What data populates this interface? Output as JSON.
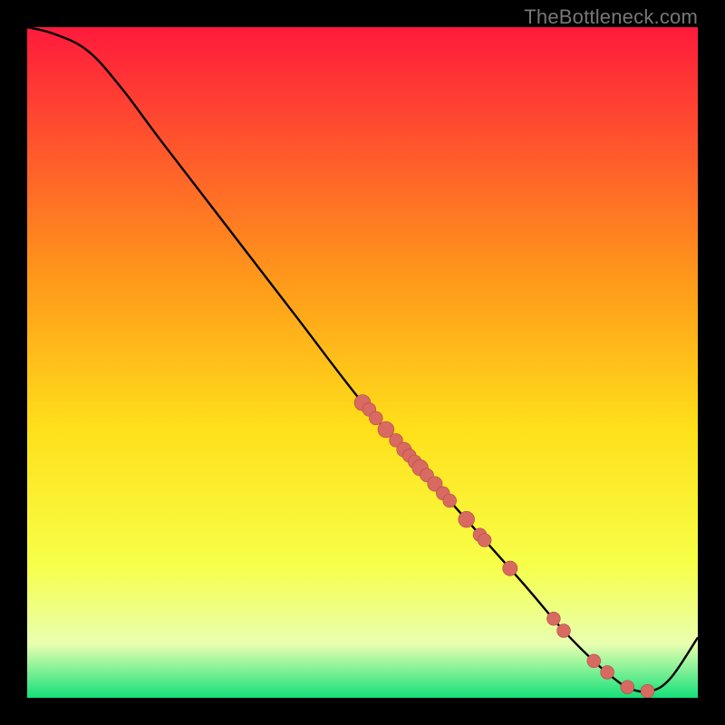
{
  "attribution": "TheBottleneck.com",
  "colors": {
    "gradient_top": "#ff1a3c",
    "gradient_upper_mid": "#ff9a1a",
    "gradient_mid": "#ffe01a",
    "gradient_lower_mid": "#f7ff48",
    "gradient_low": "#e8ffb0",
    "gradient_bottom": "#14e07a",
    "curve": "#000000",
    "dot_fill": "#d86a62",
    "dot_stroke": "#b04a44",
    "frame": "#000000"
  },
  "chart_data": {
    "type": "line",
    "title": "",
    "xlabel": "",
    "ylabel": "",
    "xlim": [
      0,
      100
    ],
    "ylim": [
      0,
      100
    ],
    "curve": {
      "x": [
        0,
        4,
        9,
        14,
        20,
        30,
        40,
        50,
        58,
        66,
        74,
        80,
        85,
        88,
        90,
        93,
        96,
        100
      ],
      "y": [
        100,
        99,
        96.5,
        91,
        83,
        70,
        57,
        44,
        35,
        26,
        17,
        10,
        5,
        2.5,
        1.3,
        1,
        3,
        9
      ]
    },
    "dots": [
      {
        "x": 50.0,
        "y": 44.0,
        "r": 1.2
      },
      {
        "x": 51.0,
        "y": 43.0,
        "r": 1.0
      },
      {
        "x": 52.0,
        "y": 41.7,
        "r": 1.0
      },
      {
        "x": 53.5,
        "y": 40.0,
        "r": 1.2
      },
      {
        "x": 55.0,
        "y": 38.4,
        "r": 1.0
      },
      {
        "x": 56.2,
        "y": 37.0,
        "r": 1.1
      },
      {
        "x": 57.0,
        "y": 36.1,
        "r": 1.0
      },
      {
        "x": 57.8,
        "y": 35.2,
        "r": 1.0
      },
      {
        "x": 58.6,
        "y": 34.3,
        "r": 1.2
      },
      {
        "x": 59.6,
        "y": 33.2,
        "r": 1.0
      },
      {
        "x": 60.8,
        "y": 31.9,
        "r": 1.1
      },
      {
        "x": 62.0,
        "y": 30.5,
        "r": 1.0
      },
      {
        "x": 63.0,
        "y": 29.4,
        "r": 1.0
      },
      {
        "x": 65.5,
        "y": 26.6,
        "r": 1.2
      },
      {
        "x": 67.5,
        "y": 24.3,
        "r": 1.0
      },
      {
        "x": 68.2,
        "y": 23.5,
        "r": 1.0
      },
      {
        "x": 72.0,
        "y": 19.3,
        "r": 1.1
      },
      {
        "x": 78.5,
        "y": 11.8,
        "r": 1.0
      },
      {
        "x": 80.0,
        "y": 10.0,
        "r": 1.0
      },
      {
        "x": 84.5,
        "y": 5.5,
        "r": 1.0
      },
      {
        "x": 86.5,
        "y": 3.8,
        "r": 1.0
      },
      {
        "x": 89.5,
        "y": 1.6,
        "r": 1.0
      },
      {
        "x": 92.5,
        "y": 1.0,
        "r": 1.0
      }
    ]
  }
}
